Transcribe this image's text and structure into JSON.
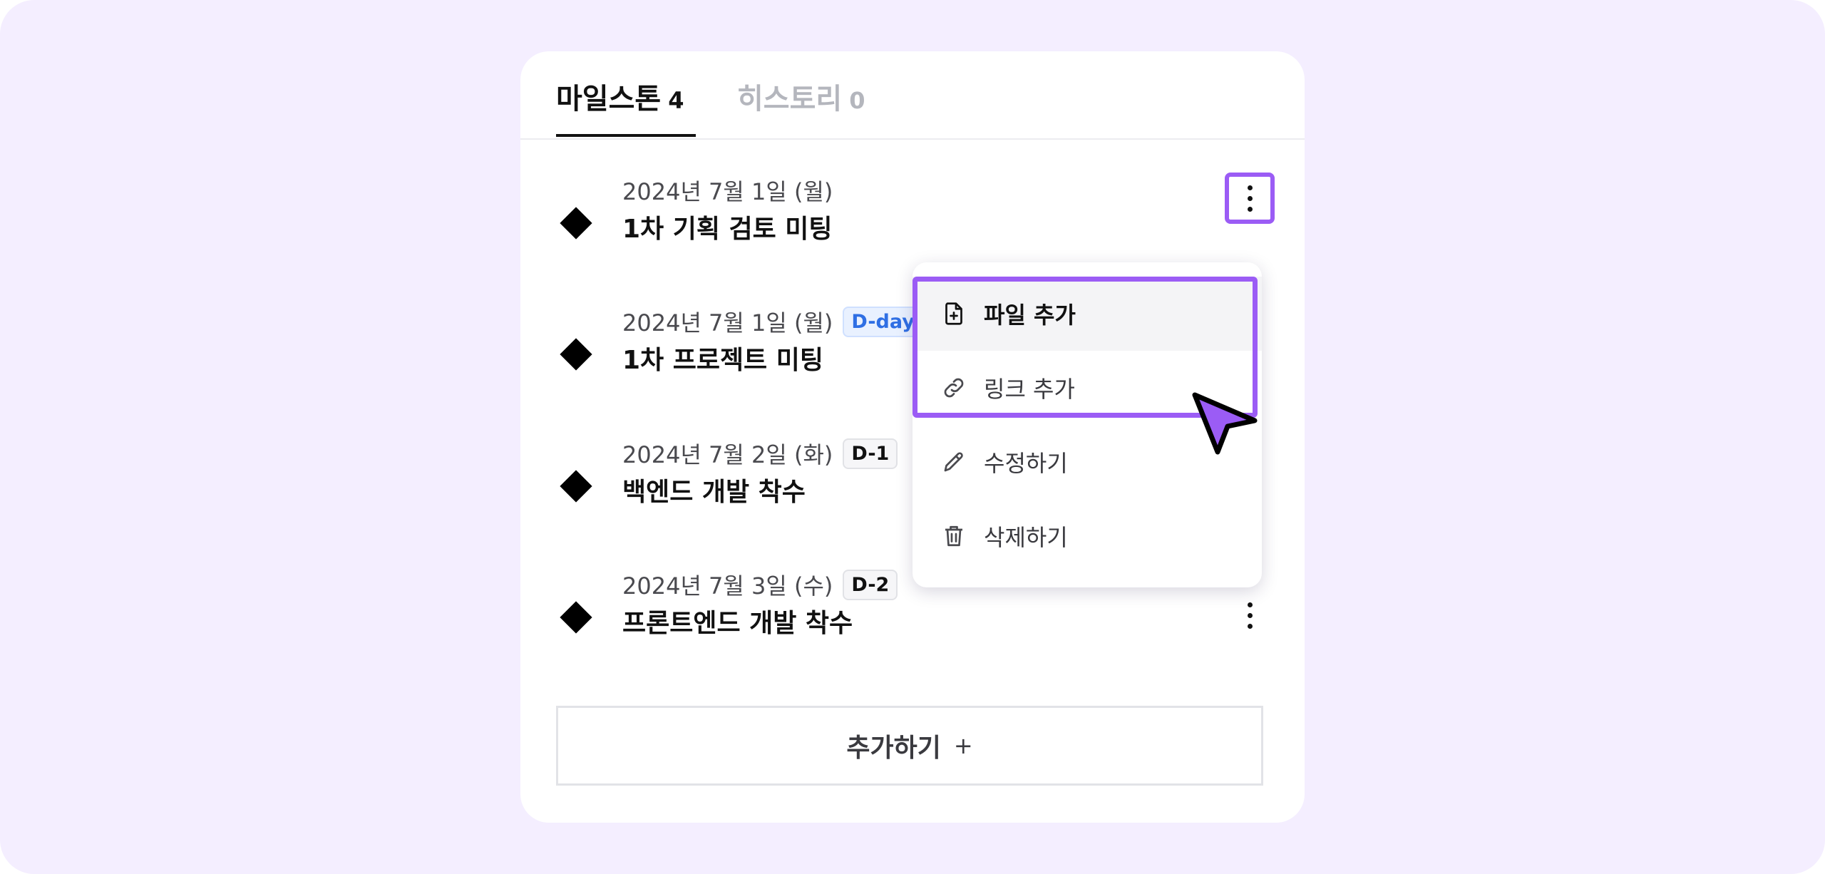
{
  "tabs": [
    {
      "label": "마일스톤",
      "count": "4"
    },
    {
      "label": "히스토리",
      "count": "0"
    }
  ],
  "milestones": [
    {
      "date": "2024년 7월 1일 (월)",
      "badge": "",
      "title": "1차 기획 검토 미팅"
    },
    {
      "date": "2024년 7월 1일 (월)",
      "badge": "D-day",
      "title": "1차 프로젝트 미팅"
    },
    {
      "date": "2024년 7월 2일 (화)",
      "badge": "D-1",
      "title": "백엔드 개발 착수"
    },
    {
      "date": "2024년 7월 3일 (수)",
      "badge": "D-2",
      "title": "프론트엔드 개발 착수"
    }
  ],
  "menu": {
    "items": [
      {
        "label": "파일 추가",
        "icon": "file-plus-icon"
      },
      {
        "label": "링크 추가",
        "icon": "link-icon"
      },
      {
        "label": "수정하기",
        "icon": "pencil-icon"
      },
      {
        "label": "삭제하기",
        "icon": "trash-icon"
      }
    ]
  },
  "add_button": {
    "label": "추가하기",
    "plus": "+"
  },
  "colors": {
    "accent": "#9b5cf5",
    "background": "#f4eeff",
    "dday": "#2f6fe4"
  }
}
